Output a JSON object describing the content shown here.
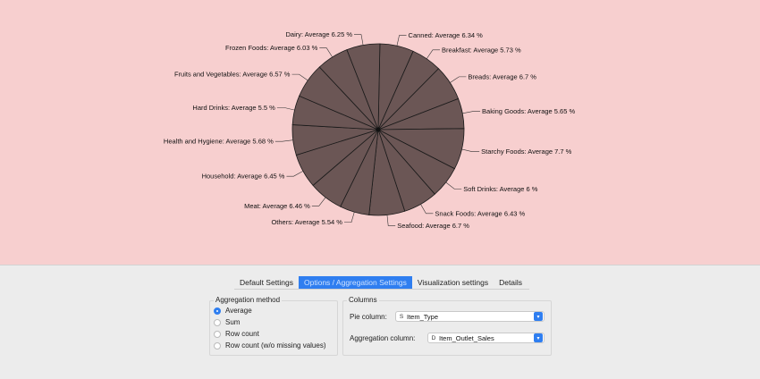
{
  "chart_data": {
    "type": "pie",
    "categories": [
      "Canned",
      "Breakfast",
      "Breads",
      "Baking Goods",
      "Starchy Foods",
      "Soft Drinks",
      "Snack Foods",
      "Seafood",
      "Others",
      "Meat",
      "Household",
      "Health and Hygiene",
      "Hard Drinks",
      "Fruits and Vegetables",
      "Frozen Foods",
      "Dairy"
    ],
    "values": [
      6.34,
      5.73,
      6.7,
      5.65,
      7.7,
      6,
      6.43,
      6.7,
      5.54,
      6.46,
      6.45,
      5.68,
      5.5,
      6.57,
      6.03,
      6.25
    ],
    "labels": [
      "Canned: Average 6.34 %",
      "Breakfast: Average 5.73 %",
      "Breads: Average 6.7 %",
      "Baking Goods: Average 5.65 %",
      "Starchy Foods: Average 7.7 %",
      "Soft Drinks: Average 6 %",
      "Snack Foods: Average 6.43 %",
      "Seafood: Average 6.7 %",
      "Others: Average 5.54 %",
      "Meat: Average 6.46 %",
      "Household: Average 6.45 %",
      "Health and Hygiene: Average 5.68 %",
      "Hard Drinks: Average 5.5 %",
      "Fruits and Vegetables: Average 6.57 %",
      "Frozen Foods: Average 6.03 %",
      "Dairy: Average 6.25 %"
    ],
    "slice_color": "#6b5655",
    "border_color": "#1a1a1a",
    "background": "#f7cfcf",
    "legend": "none"
  },
  "tabs": [
    {
      "label": "Default Settings",
      "active": false
    },
    {
      "label": "Options / Aggregation Settings",
      "active": true
    },
    {
      "label": "Visualization settings",
      "active": false
    },
    {
      "label": "Details",
      "active": false
    }
  ],
  "aggregation": {
    "title": "Aggregation method",
    "options": [
      "Average",
      "Sum",
      "Row count",
      "Row count (w/o missing values)"
    ],
    "selected": "Average"
  },
  "columns": {
    "title": "Columns",
    "pie_label": "Pie column:",
    "pie_value": "Item_Type",
    "pie_icon": "string-type-icon",
    "agg_label": "Aggregation column:",
    "agg_value": "Item_Outlet_Sales",
    "agg_icon": "double-type-icon"
  },
  "colors": {
    "accent": "#2f7ef0",
    "panel": "#ececec"
  }
}
